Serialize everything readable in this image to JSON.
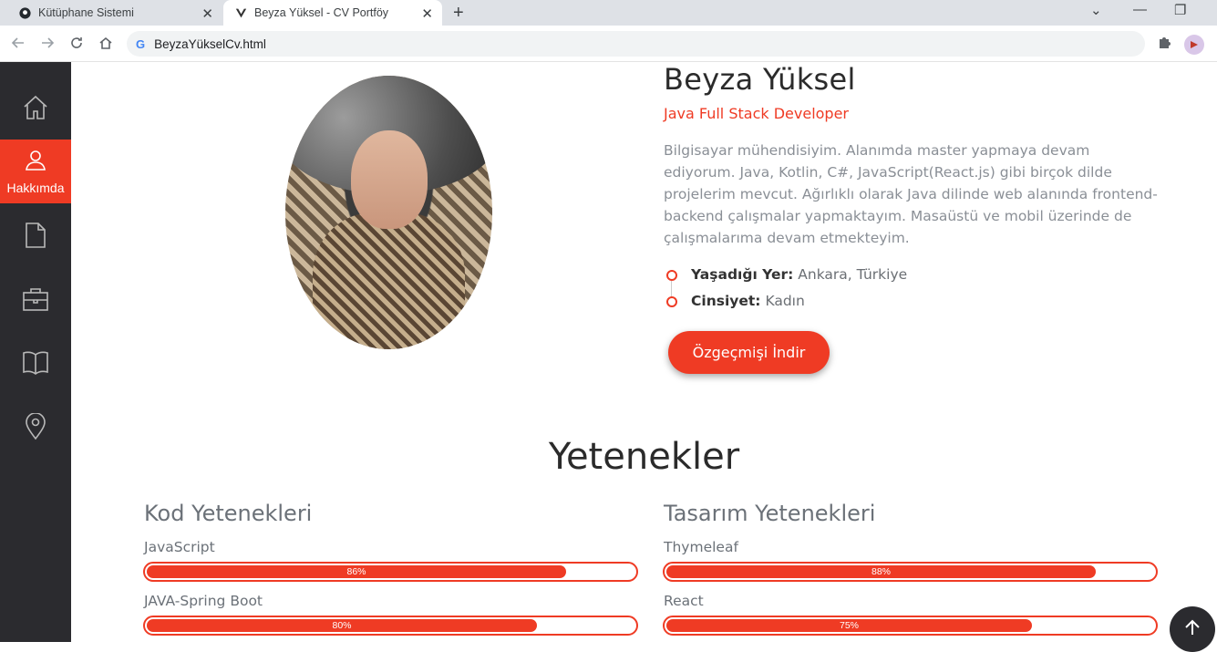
{
  "browser": {
    "tabs": [
      {
        "title": "Kütüphane Sistemi",
        "active": false
      },
      {
        "title": "Beyza Yüksel - CV Portföy",
        "active": true
      }
    ],
    "url": "BeyzaYükselCv.html"
  },
  "sidebar": {
    "items": [
      {
        "icon": "home-icon",
        "label": ""
      },
      {
        "icon": "user-icon",
        "label": "Hakkımda",
        "active": true
      },
      {
        "icon": "document-icon",
        "label": ""
      },
      {
        "icon": "briefcase-icon",
        "label": ""
      },
      {
        "icon": "book-icon",
        "label": ""
      },
      {
        "icon": "location-icon",
        "label": ""
      }
    ]
  },
  "profile": {
    "name": "Beyza Yüksel",
    "role": "Java Full Stack Developer",
    "bio": "Bilgisayar mühendisiyim. Alanımda master yapmaya devam ediyorum. Java, Kotlin, C#, JavaScript(React.js) gibi birçok dilde projelerim mevcut. Ağırlıklı olarak Java dilinde web alanında frontend-backend çalışmalar yapmaktayım. Masaüstü ve mobil üzerinde de çalışmalarıma devam etmekteyim.",
    "info": [
      {
        "key": "Yaşadığı Yer:",
        "value": "Ankara, Türkiye"
      },
      {
        "key": "Cinsiyet:",
        "value": "Kadın"
      }
    ],
    "download_label": "Özgeçmişi İndir"
  },
  "skills": {
    "title": "Yetenekler",
    "code": {
      "title": "Kod Yetenekleri",
      "items": [
        {
          "name": "JavaScript",
          "label": "86%",
          "value": 0.86
        },
        {
          "name": "JAVA-Spring Boot",
          "label": "80%",
          "value": 0.8
        }
      ]
    },
    "design": {
      "title": "Tasarım Yetenekleri",
      "items": [
        {
          "name": "Thymeleaf",
          "label": "88%",
          "value": 0.88
        },
        {
          "name": "React",
          "label": "75%",
          "value": 0.75
        }
      ]
    }
  },
  "colors": {
    "accent": "#ef3b24",
    "sidebar": "#2b2b2f"
  }
}
